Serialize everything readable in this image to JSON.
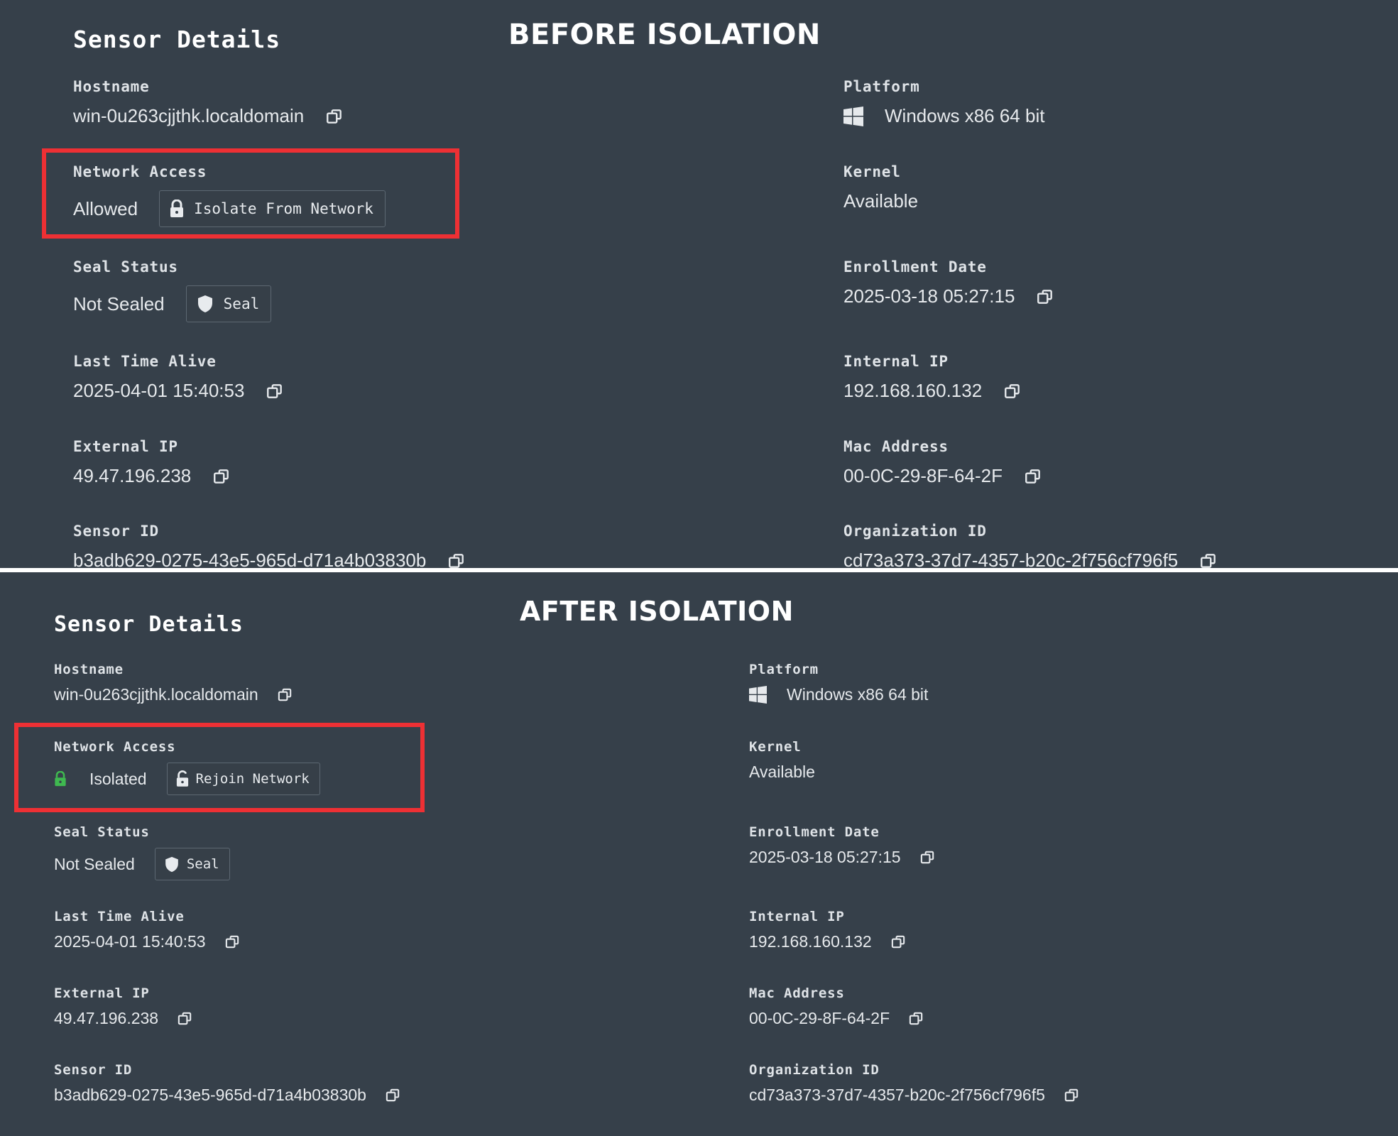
{
  "before": {
    "banner": "BEFORE ISOLATION",
    "section_title": "Sensor Details",
    "hostname": {
      "label": "Hostname",
      "value": "win-0u263cjjthk.localdomain"
    },
    "network_access": {
      "label": "Network Access",
      "value": "Allowed",
      "button": "Isolate From Network"
    },
    "seal_status": {
      "label": "Seal Status",
      "value": "Not Sealed",
      "button": "Seal"
    },
    "last_time_alive": {
      "label": "Last Time Alive",
      "value": "2025-04-01 15:40:53"
    },
    "external_ip": {
      "label": "External IP",
      "value": "49.47.196.238"
    },
    "sensor_id": {
      "label": "Sensor ID",
      "value": "b3adb629-0275-43e5-965d-d71a4b03830b"
    },
    "platform": {
      "label": "Platform",
      "value": "Windows x86 64 bit"
    },
    "kernel": {
      "label": "Kernel",
      "value": "Available"
    },
    "enrollment_date": {
      "label": "Enrollment Date",
      "value": "2025-03-18 05:27:15"
    },
    "internal_ip": {
      "label": "Internal IP",
      "value": "192.168.160.132"
    },
    "mac_address": {
      "label": "Mac Address",
      "value": "00-0C-29-8F-64-2F"
    },
    "organization_id": {
      "label": "Organization ID",
      "value": "cd73a373-37d7-4357-b20c-2f756cf796f5"
    }
  },
  "after": {
    "banner": "AFTER ISOLATION",
    "section_title": "Sensor Details",
    "hostname": {
      "label": "Hostname",
      "value": "win-0u263cjjthk.localdomain"
    },
    "network_access": {
      "label": "Network Access",
      "value": "Isolated",
      "button": "Rejoin Network"
    },
    "seal_status": {
      "label": "Seal Status",
      "value": "Not Sealed",
      "button": "Seal"
    },
    "last_time_alive": {
      "label": "Last Time Alive",
      "value": "2025-04-01 15:40:53"
    },
    "external_ip": {
      "label": "External IP",
      "value": "49.47.196.238"
    },
    "sensor_id": {
      "label": "Sensor ID",
      "value": "b3adb629-0275-43e5-965d-d71a4b03830b"
    },
    "platform": {
      "label": "Platform",
      "value": "Windows x86 64 bit"
    },
    "kernel": {
      "label": "Kernel",
      "value": "Available"
    },
    "enrollment_date": {
      "label": "Enrollment Date",
      "value": "2025-03-18 05:27:15"
    },
    "internal_ip": {
      "label": "Internal IP",
      "value": "192.168.160.132"
    },
    "mac_address": {
      "label": "Mac Address",
      "value": "00-0C-29-8F-64-2F"
    },
    "organization_id": {
      "label": "Organization ID",
      "value": "cd73a373-37d7-4357-b20c-2f756cf796f5"
    }
  },
  "icons": {
    "copy": "copy-icon",
    "windows": "windows-logo-icon",
    "lock": "lock-icon",
    "unlock": "unlock-icon",
    "shield": "shield-icon",
    "isolated_status": "green-lock-icon"
  },
  "colors": {
    "background": "#36404a",
    "highlight_box": "#ee3034",
    "isolated_green": "#3fb950",
    "button_border": "#5d6872"
  }
}
